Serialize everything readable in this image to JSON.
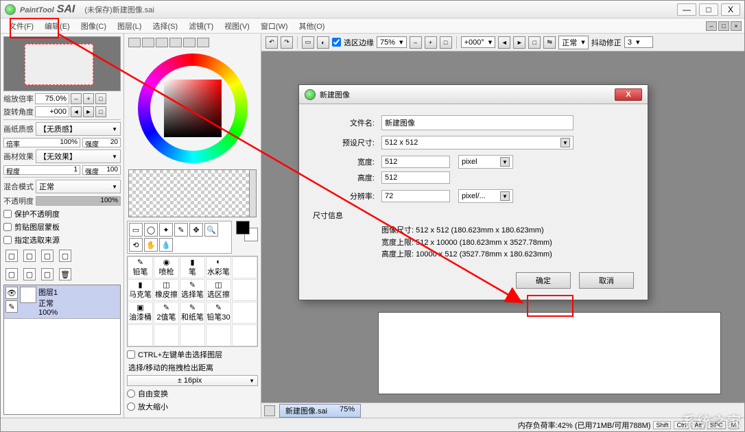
{
  "app": {
    "name_prefix": "PaintTool",
    "name_suffix": "SAI",
    "doc_title": "(未保存)新建图像.sai"
  },
  "winbtns": {
    "min": "—",
    "max": "□",
    "close": "X"
  },
  "menu": [
    "文件(F)",
    "编辑(E)",
    "图像(C)",
    "图层(L)",
    "选择(S)",
    "滤镜(T)",
    "视图(V)",
    "窗口(W)",
    "其他(O)"
  ],
  "inner_btns": [
    "–",
    "□",
    "×"
  ],
  "nav": {
    "zoom_label": "缩放倍率",
    "zoom_value": "75.0%",
    "rot_label": "旋转角度",
    "rot_value": "+000"
  },
  "paper": {
    "texture_label": "画纸质感",
    "texture_value": "【无质感】",
    "scale_label": "倍率",
    "scale_value": "100%",
    "strength_label": "强度",
    "strength_value": "20",
    "effect_label": "画材效果",
    "effect_value": "【无效果】",
    "extent_label": "程度",
    "extent_value": "1",
    "strength2_label": "强度",
    "strength2_value": "100"
  },
  "blend": {
    "label": "混合模式",
    "value": "正常"
  },
  "opacity": {
    "label": "不透明度",
    "value": "100%"
  },
  "checks": [
    "保护不透明度",
    "剪贴图层蒙板",
    "指定选取来源"
  ],
  "layer": {
    "name": "图层1",
    "mode": "正常",
    "opacity": "100%"
  },
  "brush_names": [
    "铅笔",
    "喷枪",
    "笔",
    "水彩笔",
    "",
    "马克笔",
    "橡皮擦",
    "选择笔",
    "选区擦",
    "",
    "油漆桶",
    "2值笔",
    "和纸笔",
    "铅笔30",
    ""
  ],
  "ctrl_hint": "CTRL+左键单击选择图层",
  "move_hint": "选择/移动的拖拽检出距离",
  "move_val": "± 16pix",
  "transform_opts": [
    "自由变换",
    "放大缩小"
  ],
  "canvas_top": {
    "sel_edge_label": "选区边缘",
    "zoom": "75%",
    "angle": "+000°",
    "mode": "正常",
    "stabilizer_label": "抖动修正",
    "stabilizer_value": "3"
  },
  "filetab": {
    "name": "新建图像.sai",
    "zoom": "75%"
  },
  "status": {
    "mem": "内存负荷率:42% (已用71MB/可用788M)",
    "keys": [
      "Shift",
      "Ctrl",
      "Alt",
      "SPC",
      "M"
    ]
  },
  "dialog": {
    "title": "新建图像",
    "filename_label": "文件名:",
    "filename": "新建图像",
    "preset_label": "预设尺寸:",
    "preset": "512 x  512",
    "width_label": "宽度:",
    "width": "512",
    "height_label": "高度:",
    "height": "512",
    "unit": "pixel",
    "res_label": "分辨率:",
    "res": "72",
    "res_unit": "pixel/...",
    "group_title": "尺寸信息",
    "info1": "图像尺寸:  512 x 512 (180.623mm x 180.623mm)",
    "info2": "宽度上限:  512 x 10000 (180.623mm x 3527.78mm)",
    "info3": "高度上限:  10000 x 512 (3527.78mm x 180.623mm)",
    "ok": "确定",
    "cancel": "取消"
  },
  "watermark": "系统之家"
}
